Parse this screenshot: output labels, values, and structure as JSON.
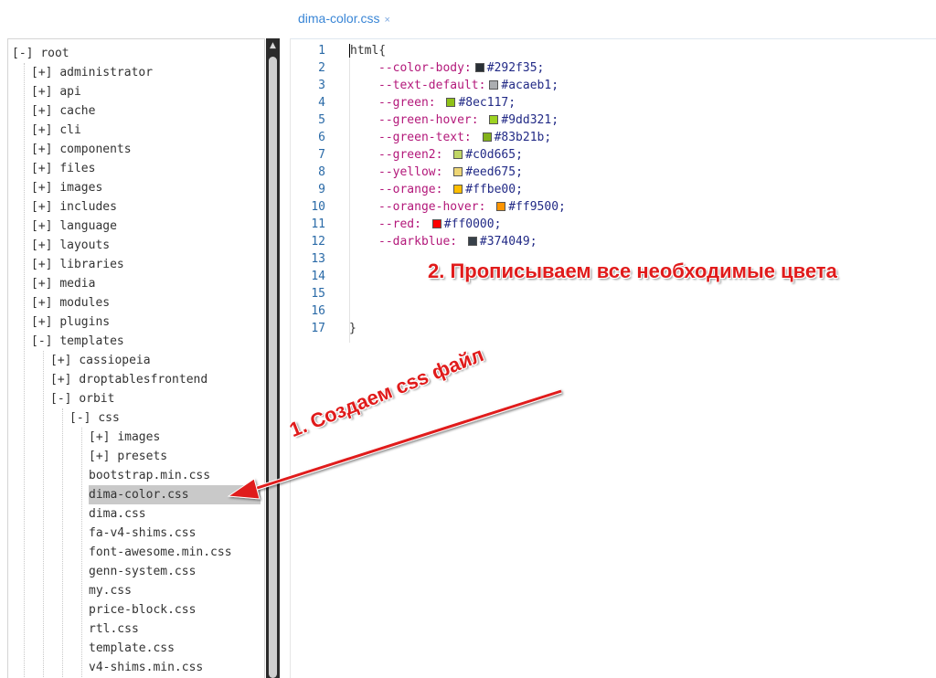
{
  "tab": {
    "label": "dima-color.css",
    "close": "×"
  },
  "tree": {
    "items": [
      {
        "toggle": "[-]",
        "label": "root",
        "depth": 0
      },
      {
        "toggle": "[+]",
        "label": "administrator",
        "depth": 1
      },
      {
        "toggle": "[+]",
        "label": "api",
        "depth": 1
      },
      {
        "toggle": "[+]",
        "label": "cache",
        "depth": 1
      },
      {
        "toggle": "[+]",
        "label": "cli",
        "depth": 1
      },
      {
        "toggle": "[+]",
        "label": "components",
        "depth": 1
      },
      {
        "toggle": "[+]",
        "label": "files",
        "depth": 1
      },
      {
        "toggle": "[+]",
        "label": "images",
        "depth": 1
      },
      {
        "toggle": "[+]",
        "label": "includes",
        "depth": 1
      },
      {
        "toggle": "[+]",
        "label": "language",
        "depth": 1
      },
      {
        "toggle": "[+]",
        "label": "layouts",
        "depth": 1
      },
      {
        "toggle": "[+]",
        "label": "libraries",
        "depth": 1
      },
      {
        "toggle": "[+]",
        "label": "media",
        "depth": 1
      },
      {
        "toggle": "[+]",
        "label": "modules",
        "depth": 1
      },
      {
        "toggle": "[+]",
        "label": "plugins",
        "depth": 1
      },
      {
        "toggle": "[-]",
        "label": "templates",
        "depth": 1
      },
      {
        "toggle": "[+]",
        "label": "cassiopeia",
        "depth": 2
      },
      {
        "toggle": "[+]",
        "label": "droptablesfrontend",
        "depth": 2
      },
      {
        "toggle": "[-]",
        "label": "orbit",
        "depth": 2
      },
      {
        "toggle": "[-]",
        "label": "css",
        "depth": 3
      },
      {
        "toggle": "[+]",
        "label": "images",
        "depth": 4
      },
      {
        "toggle": "[+]",
        "label": "presets",
        "depth": 4
      },
      {
        "toggle": "",
        "label": "bootstrap.min.css",
        "depth": 4
      },
      {
        "toggle": "",
        "label": "dima-color.css",
        "depth": 4,
        "selected": true
      },
      {
        "toggle": "",
        "label": "dima.css",
        "depth": 4
      },
      {
        "toggle": "",
        "label": "fa-v4-shims.css",
        "depth": 4
      },
      {
        "toggle": "",
        "label": "font-awesome.min.css",
        "depth": 4
      },
      {
        "toggle": "",
        "label": "genn-system.css",
        "depth": 4
      },
      {
        "toggle": "",
        "label": "my.css",
        "depth": 4
      },
      {
        "toggle": "",
        "label": "price-block.css",
        "depth": 4
      },
      {
        "toggle": "",
        "label": "rtl.css",
        "depth": 4
      },
      {
        "toggle": "",
        "label": "template.css",
        "depth": 4
      },
      {
        "toggle": "",
        "label": "v4-shims.min.css",
        "depth": 4
      }
    ]
  },
  "editor": {
    "lines": [
      {
        "n": "1",
        "kind": "open",
        "text": "html{"
      },
      {
        "n": "2",
        "kind": "decl",
        "prop": "--color-body:",
        "value": "#292f35;",
        "swatch": "#292f35"
      },
      {
        "n": "3",
        "kind": "decl",
        "prop": "--text-default:",
        "value": "#acaeb1;",
        "swatch": "#acaeb1"
      },
      {
        "n": "4",
        "kind": "decl",
        "prop": "--green: ",
        "value": "#8ec117;",
        "swatch": "#8ec117"
      },
      {
        "n": "5",
        "kind": "decl",
        "prop": "--green-hover: ",
        "value": "#9dd321;",
        "swatch": "#9dd321"
      },
      {
        "n": "6",
        "kind": "decl",
        "prop": "--green-text: ",
        "value": "#83b21b;",
        "swatch": "#83b21b"
      },
      {
        "n": "7",
        "kind": "decl",
        "prop": "--green2: ",
        "value": "#c0d665;",
        "swatch": "#c0d665"
      },
      {
        "n": "8",
        "kind": "decl",
        "prop": "--yellow: ",
        "value": "#eed675;",
        "swatch": "#eed675"
      },
      {
        "n": "9",
        "kind": "decl",
        "prop": "--orange: ",
        "value": "#ffbe00;",
        "swatch": "#ffbe00"
      },
      {
        "n": "10",
        "kind": "decl",
        "prop": "--orange-hover: ",
        "value": "#ff9500;",
        "swatch": "#ff9500"
      },
      {
        "n": "11",
        "kind": "decl",
        "prop": "--red: ",
        "value": "#ff0000;",
        "swatch": "#ff0000"
      },
      {
        "n": "12",
        "kind": "decl",
        "prop": "--darkblue: ",
        "value": "#374049;",
        "swatch": "#374049"
      },
      {
        "n": "13",
        "kind": "blank",
        "text": ""
      },
      {
        "n": "14",
        "kind": "blank",
        "text": ""
      },
      {
        "n": "15",
        "kind": "blank",
        "text": ""
      },
      {
        "n": "16",
        "kind": "blank",
        "text": ""
      },
      {
        "n": "17",
        "kind": "close",
        "text": "}"
      }
    ]
  },
  "annotations": {
    "step1": "1. Создаем css файл",
    "step2": "2. Прописываем все необходимые цвета"
  },
  "colors": {
    "accent": "#3a86d6",
    "annotation": "#e01b1b",
    "selected_row": "#c9c9c9",
    "scrollbar": "#2b2b2b"
  }
}
